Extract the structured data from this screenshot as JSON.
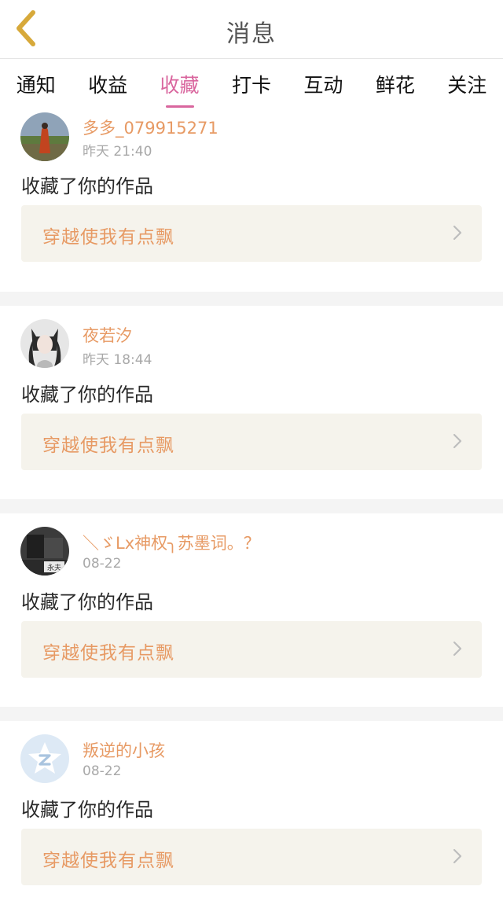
{
  "header": {
    "title": "消息"
  },
  "tabs": [
    {
      "label": "通知",
      "active": false
    },
    {
      "label": "收益",
      "active": false
    },
    {
      "label": "收藏",
      "active": true
    },
    {
      "label": "打卡",
      "active": false
    },
    {
      "label": "互动",
      "active": false
    },
    {
      "label": "鲜花",
      "active": false
    },
    {
      "label": "关注",
      "active": false
    }
  ],
  "messages": [
    {
      "user": "多多_079915271",
      "time": "昨天 21:40",
      "action": "收藏了你的作品",
      "work_title": "穿越使我有点飘"
    },
    {
      "user": "夜若汐",
      "time": "昨天 18:44",
      "action": "收藏了你的作品",
      "work_title": "穿越使我有点飘"
    },
    {
      "user": "＼ゞLx神权╮苏墨词。？",
      "time": "08-22",
      "action": "收藏了你的作品",
      "work_title": "穿越使我有点飘",
      "avatar_text": "永夫"
    },
    {
      "user": "叛逆的小孩",
      "time": "08-22",
      "action": "收藏了你的作品",
      "work_title": "穿越使我有点飘"
    }
  ],
  "colors": {
    "accent": "#d9669e",
    "orange": "#e79a64",
    "back_icon": "#d7a93a"
  }
}
